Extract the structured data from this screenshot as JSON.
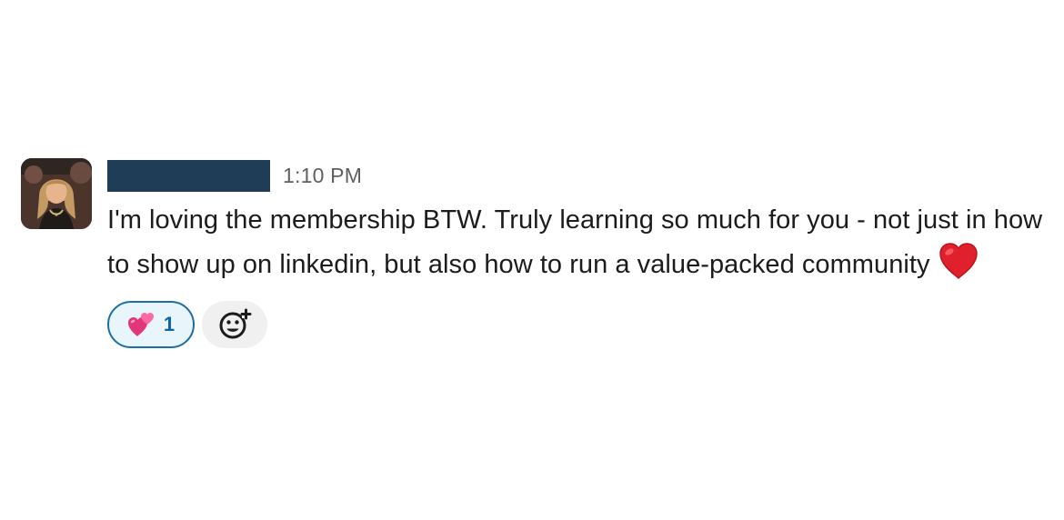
{
  "message": {
    "timestamp": "1:10 PM",
    "text": "I'm loving the membership BTW. Truly learning so much for you - not just in how to show up on linkedin, but also how to run a value-packed community",
    "inline_emoji": "heart-emoji"
  },
  "reactions": [
    {
      "emoji": "two-hearts-emoji",
      "count": "1"
    }
  ],
  "add_reaction": {
    "icon": "add-reaction-icon"
  },
  "colors": {
    "name_redaction": "#1f3d57",
    "timestamp": "#616061",
    "reaction_border": "#1d6fa3",
    "reaction_bg": "#e8f5fa",
    "reaction_count": "#1264a3",
    "add_reaction_bg": "#f0f0f0"
  }
}
